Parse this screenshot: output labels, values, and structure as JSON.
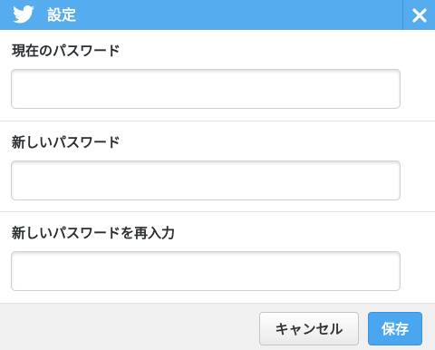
{
  "window": {
    "title": "設定",
    "logo_icon": "twitter-bird-icon",
    "close_icon": "close-icon"
  },
  "fields": [
    {
      "label": "現在のパスワード",
      "value": "",
      "placeholder": ""
    },
    {
      "label": "新しいパスワード",
      "value": "",
      "placeholder": ""
    },
    {
      "label": "新しいパスワードを再入力",
      "value": "",
      "placeholder": ""
    }
  ],
  "footer": {
    "cancel_label": "キャンセル",
    "save_label": "保存"
  },
  "colors": {
    "titlebar": "#55acee",
    "save_button": "#4aa6ef",
    "footer_bg": "#f0f0f0"
  }
}
